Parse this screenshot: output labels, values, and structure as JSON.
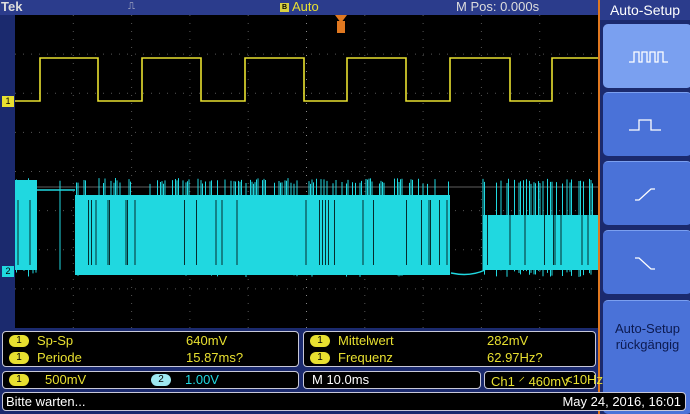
{
  "header": {
    "brand": "Tek",
    "trigger_mode": "Auto",
    "trigger_badge": "B",
    "trigger_icon": "pulse-icon",
    "m_pos": "M Pos: 0.000s"
  },
  "right_menu": {
    "title": "Auto-Setup",
    "buttons": [
      {
        "icon": "multi-pulse-icon"
      },
      {
        "icon": "single-pulse-icon"
      },
      {
        "icon": "rising-edge-icon"
      },
      {
        "icon": "falling-edge-icon"
      },
      {
        "label_line1": "Auto-Setup",
        "label_line2": "rückgängig"
      }
    ]
  },
  "measurements": {
    "left": [
      {
        "ch": "1",
        "name": "Sp-Sp",
        "value": "640mV"
      },
      {
        "ch": "1",
        "name": "Periode",
        "value": "15.87ms?"
      }
    ],
    "right": [
      {
        "ch": "1",
        "name": "Mittelwert",
        "value": "282mV"
      },
      {
        "ch": "1",
        "name": "Frequenz",
        "value": "62.97Hz?"
      }
    ]
  },
  "channels": {
    "ch1": {
      "num": "1",
      "scale": "500mV",
      "color": "#e8e030"
    },
    "ch2": {
      "num": "2",
      "scale": "1.00V",
      "color": "#20d8e0"
    }
  },
  "timebase": "M 10.0ms",
  "trigger": {
    "text": "Ch1 ⸍ 460mV",
    "freq": "<10Hz"
  },
  "status": {
    "message": "Bitte warten...",
    "datetime": "May 24, 2016, 16:01"
  }
}
